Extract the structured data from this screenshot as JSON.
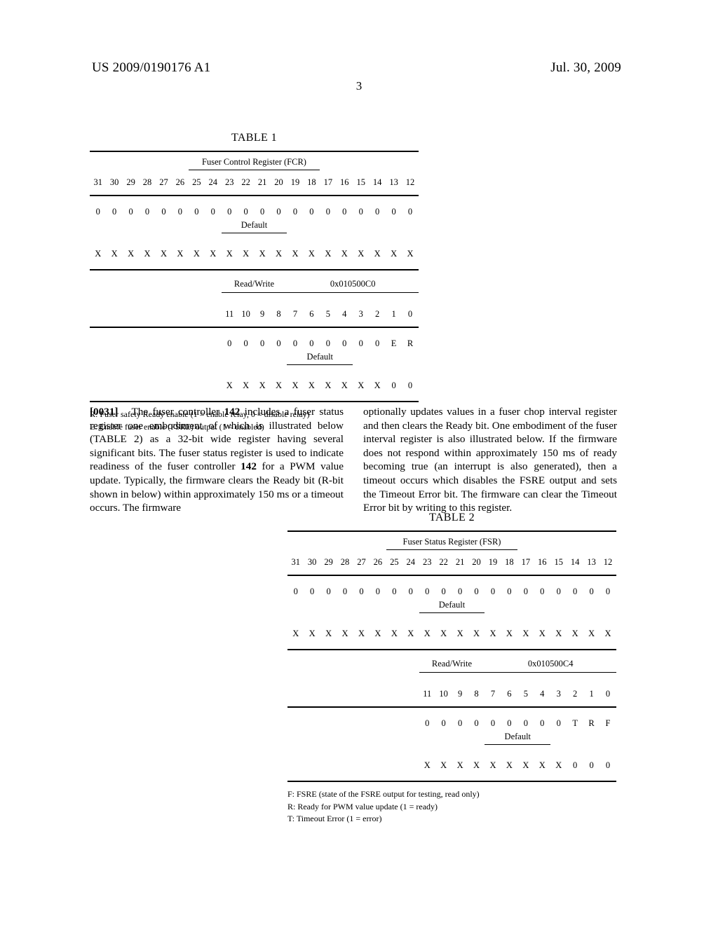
{
  "header": {
    "publication_number": "US 2009/0190176 A1",
    "publication_date": "Jul. 30, 2009",
    "page_number": "3"
  },
  "table1": {
    "caption": "TABLE 1",
    "register_title": "Fuser Control Register (FCR)",
    "high_bits": [
      "31",
      "30",
      "29",
      "28",
      "27",
      "26",
      "25",
      "24",
      "23",
      "22",
      "21",
      "20",
      "19",
      "18",
      "17",
      "16",
      "15",
      "14",
      "13",
      "12"
    ],
    "high_default_values": [
      "0",
      "0",
      "0",
      "0",
      "0",
      "0",
      "0",
      "0",
      "0",
      "0",
      "0",
      "0",
      "0",
      "0",
      "0",
      "0",
      "0",
      "0",
      "0",
      "0"
    ],
    "high_access_values": [
      "X",
      "X",
      "X",
      "X",
      "X",
      "X",
      "X",
      "X",
      "X",
      "X",
      "X",
      "X",
      "X",
      "X",
      "X",
      "X",
      "X",
      "X",
      "X",
      "X"
    ],
    "default_label": "Default",
    "access_label": "Read/Write",
    "address": "0x010500C0",
    "low_bits": [
      "11",
      "10",
      "9",
      "8",
      "7",
      "6",
      "5",
      "4",
      "3",
      "2",
      "1",
      "0"
    ],
    "low_default_values": [
      "0",
      "0",
      "0",
      "0",
      "0",
      "0",
      "0",
      "0",
      "0",
      "0",
      "E",
      "R"
    ],
    "low_access_values": [
      "X",
      "X",
      "X",
      "X",
      "X",
      "X",
      "X",
      "X",
      "X",
      "X",
      "0",
      "0"
    ],
    "footnotes": [
      "R: Fuser safety Ready enable (1 = enable relay, 0 = disable relay)",
      "E: Enable fuser enable (FSRE) output (1 = enabled)"
    ]
  },
  "table2": {
    "caption": "TABLE 2",
    "register_title": "Fuser Status Register (FSR)",
    "high_bits": [
      "31",
      "30",
      "29",
      "28",
      "27",
      "26",
      "25",
      "24",
      "23",
      "22",
      "21",
      "20",
      "19",
      "18",
      "17",
      "16",
      "15",
      "14",
      "13",
      "12"
    ],
    "high_default_values": [
      "0",
      "0",
      "0",
      "0",
      "0",
      "0",
      "0",
      "0",
      "0",
      "0",
      "0",
      "0",
      "0",
      "0",
      "0",
      "0",
      "0",
      "0",
      "0",
      "0"
    ],
    "high_access_values": [
      "X",
      "X",
      "X",
      "X",
      "X",
      "X",
      "X",
      "X",
      "X",
      "X",
      "X",
      "X",
      "X",
      "X",
      "X",
      "X",
      "X",
      "X",
      "X",
      "X"
    ],
    "default_label": "Default",
    "access_label": "Read/Write",
    "address": "0x010500C4",
    "low_bits": [
      "11",
      "10",
      "9",
      "8",
      "7",
      "6",
      "5",
      "4",
      "3",
      "2",
      "1",
      "0"
    ],
    "low_default_values": [
      "0",
      "0",
      "0",
      "0",
      "0",
      "0",
      "0",
      "0",
      "0",
      "T",
      "R",
      "F"
    ],
    "low_access_values": [
      "X",
      "X",
      "X",
      "X",
      "X",
      "X",
      "X",
      "X",
      "X",
      "0",
      "0",
      "0"
    ],
    "footnotes": [
      "F: FSRE (state of the FSRE output for testing, read only)",
      "R: Ready for PWM value update (1 = ready)",
      "T: Timeout Error (1 = error)"
    ]
  },
  "body": {
    "left_paragraph_number": "[0031]",
    "left_paragraph_text": "The fuser controller 142 includes a fuser status register one embodiment of which is illustrated below (TABLE 2) as a 32-bit wide register having several significant bits. The fuser status register is used to indicate readiness of the fuser controller 142 for a PWM value update. Typically, the firmware clears the Ready bit (R-bit shown in below) within approximately 150 ms or a timeout occurs. The firmware",
    "right_paragraph_text": "optionally updates values in a fuser chop interval register and then clears the Ready bit. One embodiment of the fuser interval register is also illustrated below. If the firmware does not respond within approximately 150 ms of ready becoming true (an interrupt is also generated), then a timeout occurs which disables the FSRE output and sets the Timeout Error bit. The firmware can clear the Timeout Error bit by writing to this register."
  }
}
